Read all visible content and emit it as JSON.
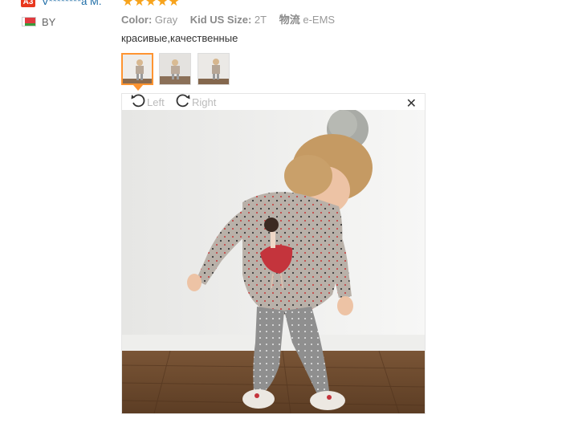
{
  "reviewer": {
    "avatar_initials": "A3",
    "name": "V********a M.",
    "country": "BY"
  },
  "rating": {
    "stars_text": "★★★★★",
    "value": 5,
    "max": 5
  },
  "attributes": [
    {
      "key": "Color:",
      "value": "Gray"
    },
    {
      "key": "Kid US Size:",
      "value": "2T"
    },
    {
      "key": "物流",
      "value": "e-EMS"
    }
  ],
  "feedback_text": "красивые,качественные",
  "viewer": {
    "rotate_left_label": "Left",
    "rotate_right_label": "Right",
    "close_glyph": "✕"
  },
  "icons": {
    "rotate_left": "rotate-left-icon",
    "rotate_right": "rotate-right-icon",
    "close": "close-icon"
  },
  "colors": {
    "accent": "#ff9431",
    "star": "#f7a31c",
    "link": "#1a6aa5"
  }
}
